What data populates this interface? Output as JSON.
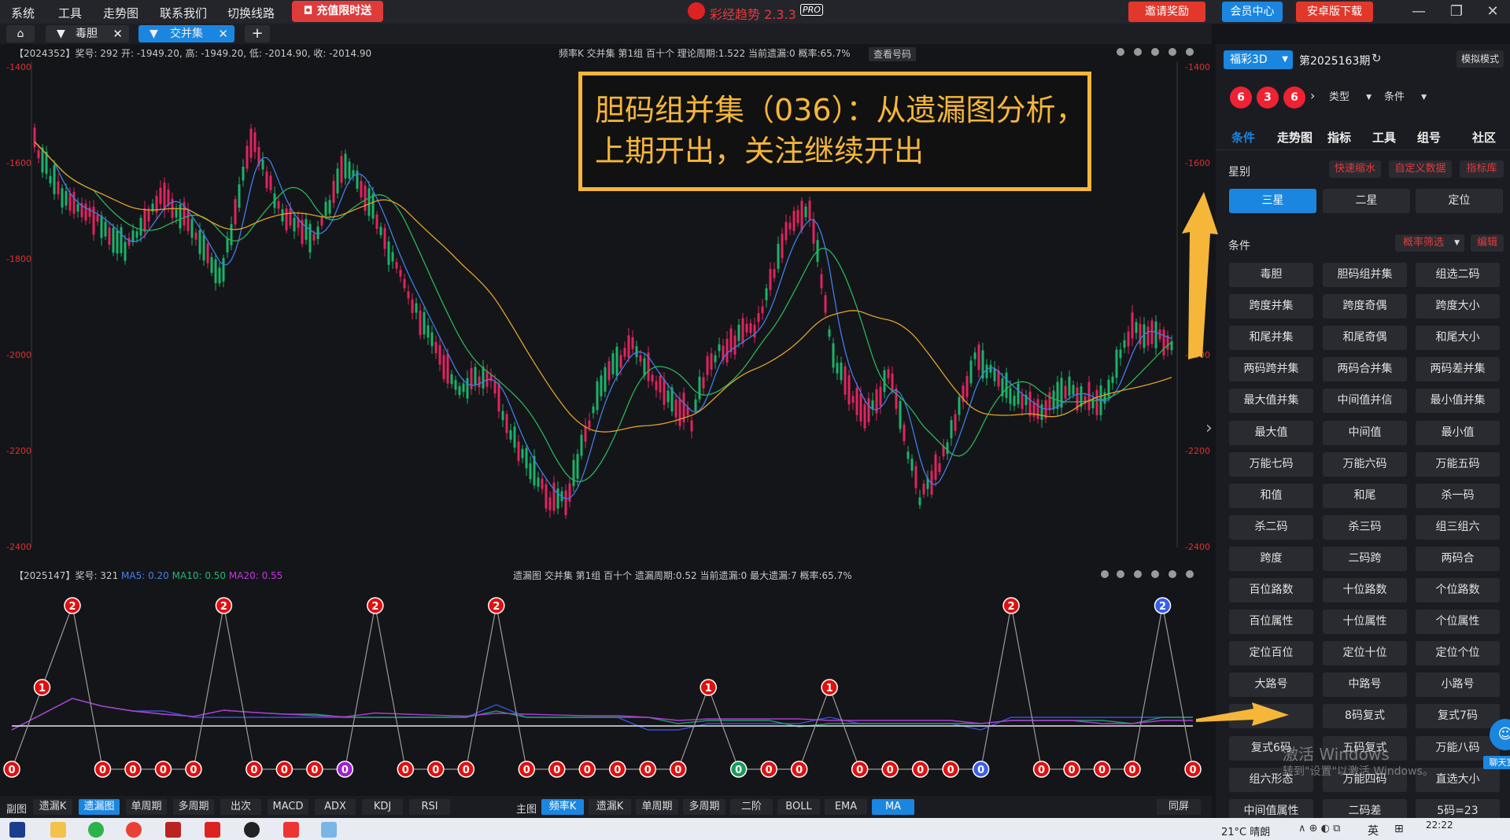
{
  "menubar": {
    "items": [
      "系统",
      "工具",
      "走势图",
      "联系我们",
      "切换线路"
    ],
    "promo": "充值限时送",
    "app_name": "彩经趋势 2.3.3",
    "pro": "PRO",
    "invite": "邀请奖励",
    "member": "会员中心",
    "android": "安卓版下载"
  },
  "tabs": {
    "tab1": "毒胆",
    "tab2": "交并集"
  },
  "upper_chart": {
    "left_info": "【2024352】奖号: 292  开: -1949.20, 高: -1949.20, 低: -2014.90, 收: -2014.90",
    "center_info": "频率K  交并集  第1组  百十个  理论周期:1.522  当前遗漏:0  概率:65.7%",
    "view_btn": "查看号码",
    "y_ticks": [
      "-1400",
      "-1600",
      "-1800",
      "-2000",
      "-2200",
      "-2400"
    ]
  },
  "annotation": {
    "line1": "胆码组并集（036）：从遗漏图分析，",
    "line2": "上期开出，关注继续开出"
  },
  "lower_chart": {
    "left_info_main": "【2025147】奖号: 321",
    "ma5": "MA5: 0.20",
    "ma10": "MA10: 0.50",
    "ma20": "MA20: 0.55",
    "center_info": "遗漏图  交并集  第1组  百十个  遗漏周期:0.52  当前遗漏:0  最大遗漏:7  概率:65.7%"
  },
  "chart_data": {
    "type": "line",
    "title": "",
    "series": [
      {
        "values": [
          0,
          1,
          2,
          0,
          0,
          0,
          0,
          2,
          0,
          0,
          0,
          0,
          2,
          0,
          0,
          0,
          2,
          0,
          0,
          0,
          0,
          0,
          0,
          1,
          0,
          0,
          0,
          1,
          0,
          0,
          0,
          0,
          0,
          2,
          0,
          0,
          0,
          0,
          2,
          0
        ]
      }
    ],
    "colors": {
      "red": "#e01010",
      "purple": "#a020d0",
      "blue": "#3a5fe8",
      "green": "#1a9a5a"
    },
    "special_points": {
      "2": "red",
      "7": "red",
      "11": "purple",
      "15": "red",
      "19": "red",
      "24": "green",
      "32": "blue",
      "37": "red",
      "38": "blue"
    }
  },
  "bottom_tabs_left": {
    "label": "副图",
    "items": [
      "遗漏K",
      "遗漏图",
      "单周期",
      "多周期",
      "出次",
      "MACD",
      "ADX",
      "KDJ",
      "RSI"
    ]
  },
  "bottom_tabs_right": {
    "label": "主图",
    "items": [
      "频率K",
      "遗漏K",
      "单周期",
      "多周期",
      "二阶",
      "BOLL",
      "EMA",
      "MA"
    ],
    "same_screen": "同屏"
  },
  "right_panel": {
    "lottery": "福彩3D",
    "period": "第2025163期",
    "sim_mode": "模拟模式",
    "balls": [
      "6",
      "3",
      "6"
    ],
    "type_select": "类型",
    "cond_select": "条件",
    "tabs": [
      "条件",
      "走势图",
      "指标",
      "工具",
      "组号",
      "社区"
    ],
    "star_label": "星别",
    "star_links": [
      "快速缩水",
      "自定义数据",
      "指标库"
    ],
    "stars": [
      "三星",
      "二星",
      "定位"
    ],
    "cond_label": "条件",
    "prob_filter": "概率筛选",
    "edit": "编辑",
    "buttons": [
      "毒胆",
      "胆码组并集",
      "组选二码",
      "跨度并集",
      "跨度奇偶",
      "跨度大小",
      "和尾并集",
      "和尾奇偶",
      "和尾大小",
      "两码跨并集",
      "两码合并集",
      "两码差并集",
      "最大值并集",
      "中间值并信",
      "最小值并集",
      "最大值",
      "中间值",
      "最小值",
      "万能七码",
      "万能六码",
      "万能五码",
      "和值",
      "和尾",
      "杀一码",
      "杀二码",
      "杀三码",
      "组三组六",
      "跨度",
      "二码跨",
      "两码合",
      "百位路数",
      "十位路数",
      "个位路数",
      "百位属性",
      "十位属性",
      "个位属性",
      "定位百位",
      "定位十位",
      "定位个位",
      "大路号",
      "中路号",
      "小路号",
      "",
      "8码复式",
      "复式7码",
      "复式6码",
      "五码复式",
      "万能八码",
      "组六形态",
      "万能四码",
      "直选大小",
      "中间值属性",
      "二码差",
      "5码=23"
    ],
    "chat": "聊天室"
  },
  "taskbar": {
    "weather": "21°C 晴朗",
    "ime": "英",
    "time": "22:22",
    "watermark1": "激活 Windows",
    "watermark2": "转到\"设置\"以激活 Windows。"
  }
}
